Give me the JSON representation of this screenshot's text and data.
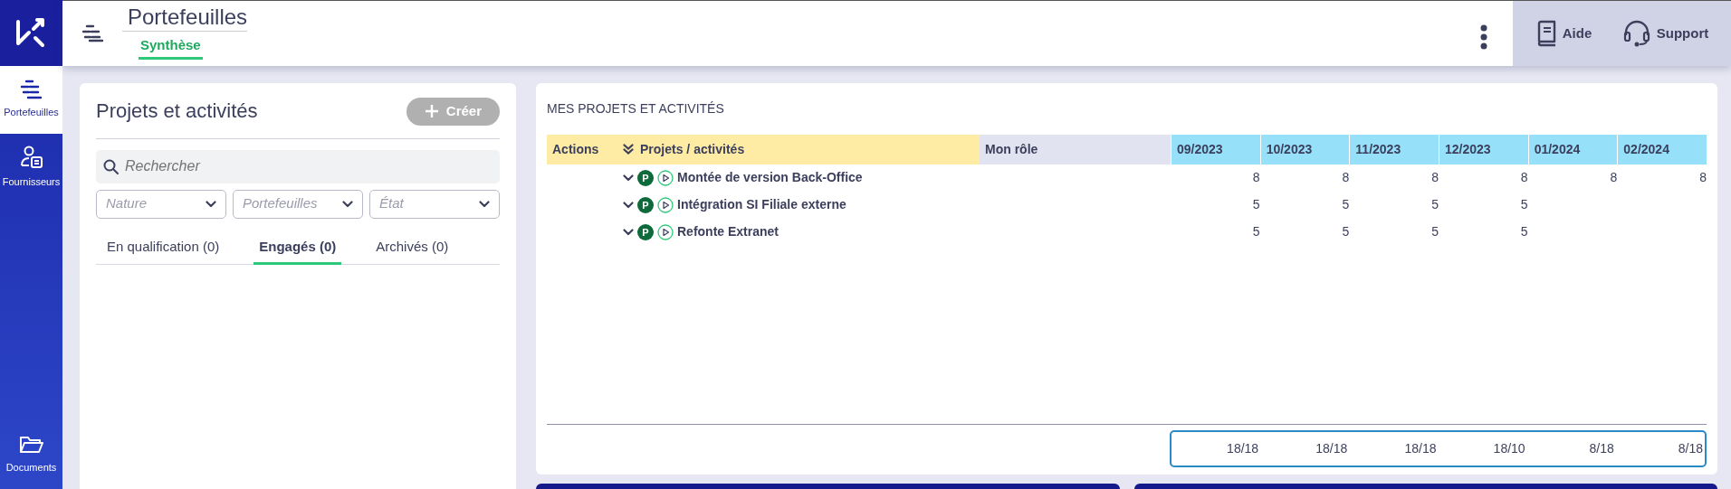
{
  "sidebar": {
    "items": [
      {
        "label": "Portefeuilles",
        "selected": true
      },
      {
        "label": "Fournisseurs",
        "selected": false
      },
      {
        "label": "Documents",
        "selected": false
      }
    ]
  },
  "header": {
    "title": "Portefeuilles",
    "tabs": [
      {
        "label": "Synthèse",
        "selected": true
      }
    ],
    "help": [
      {
        "label": "Aide"
      },
      {
        "label": "Support"
      }
    ]
  },
  "left_panel": {
    "title": "Projets et activités",
    "create_button": {
      "label": "Créer",
      "disabled": true
    },
    "search": {
      "placeholder": "Rechercher"
    },
    "filters": [
      {
        "placeholder": "Nature"
      },
      {
        "placeholder": "Portefeuilles"
      },
      {
        "placeholder": "État"
      }
    ],
    "tabs": [
      {
        "label": "En qualification (0)",
        "selected": false
      },
      {
        "label": "Engagés (0)",
        "selected": true
      },
      {
        "label": "Archivés (0)",
        "selected": false
      }
    ]
  },
  "right_panel": {
    "title": "MES PROJETS ET ACTIVITÉS",
    "table": {
      "columns": [
        "Actions",
        "Projets / activités",
        "Mon rôle",
        "09/2023",
        "10/2023",
        "11/2023",
        "12/2023",
        "01/2024",
        "02/2024"
      ],
      "rows": [
        {
          "badge": "P",
          "name": "Montée de version Back-Office",
          "values": [
            "8",
            "8",
            "8",
            "8",
            "8",
            "8"
          ]
        },
        {
          "badge": "P",
          "name": "Intégration SI Filiale externe",
          "values": [
            "5",
            "5",
            "5",
            "5"
          ]
        },
        {
          "badge": "P",
          "name": "Refonte Extranet",
          "values": [
            "5",
            "5",
            "5",
            "5"
          ]
        }
      ],
      "totals": [
        "18/18",
        "18/18",
        "18/18",
        "18/10",
        "8/18",
        "8/18"
      ]
    }
  }
}
